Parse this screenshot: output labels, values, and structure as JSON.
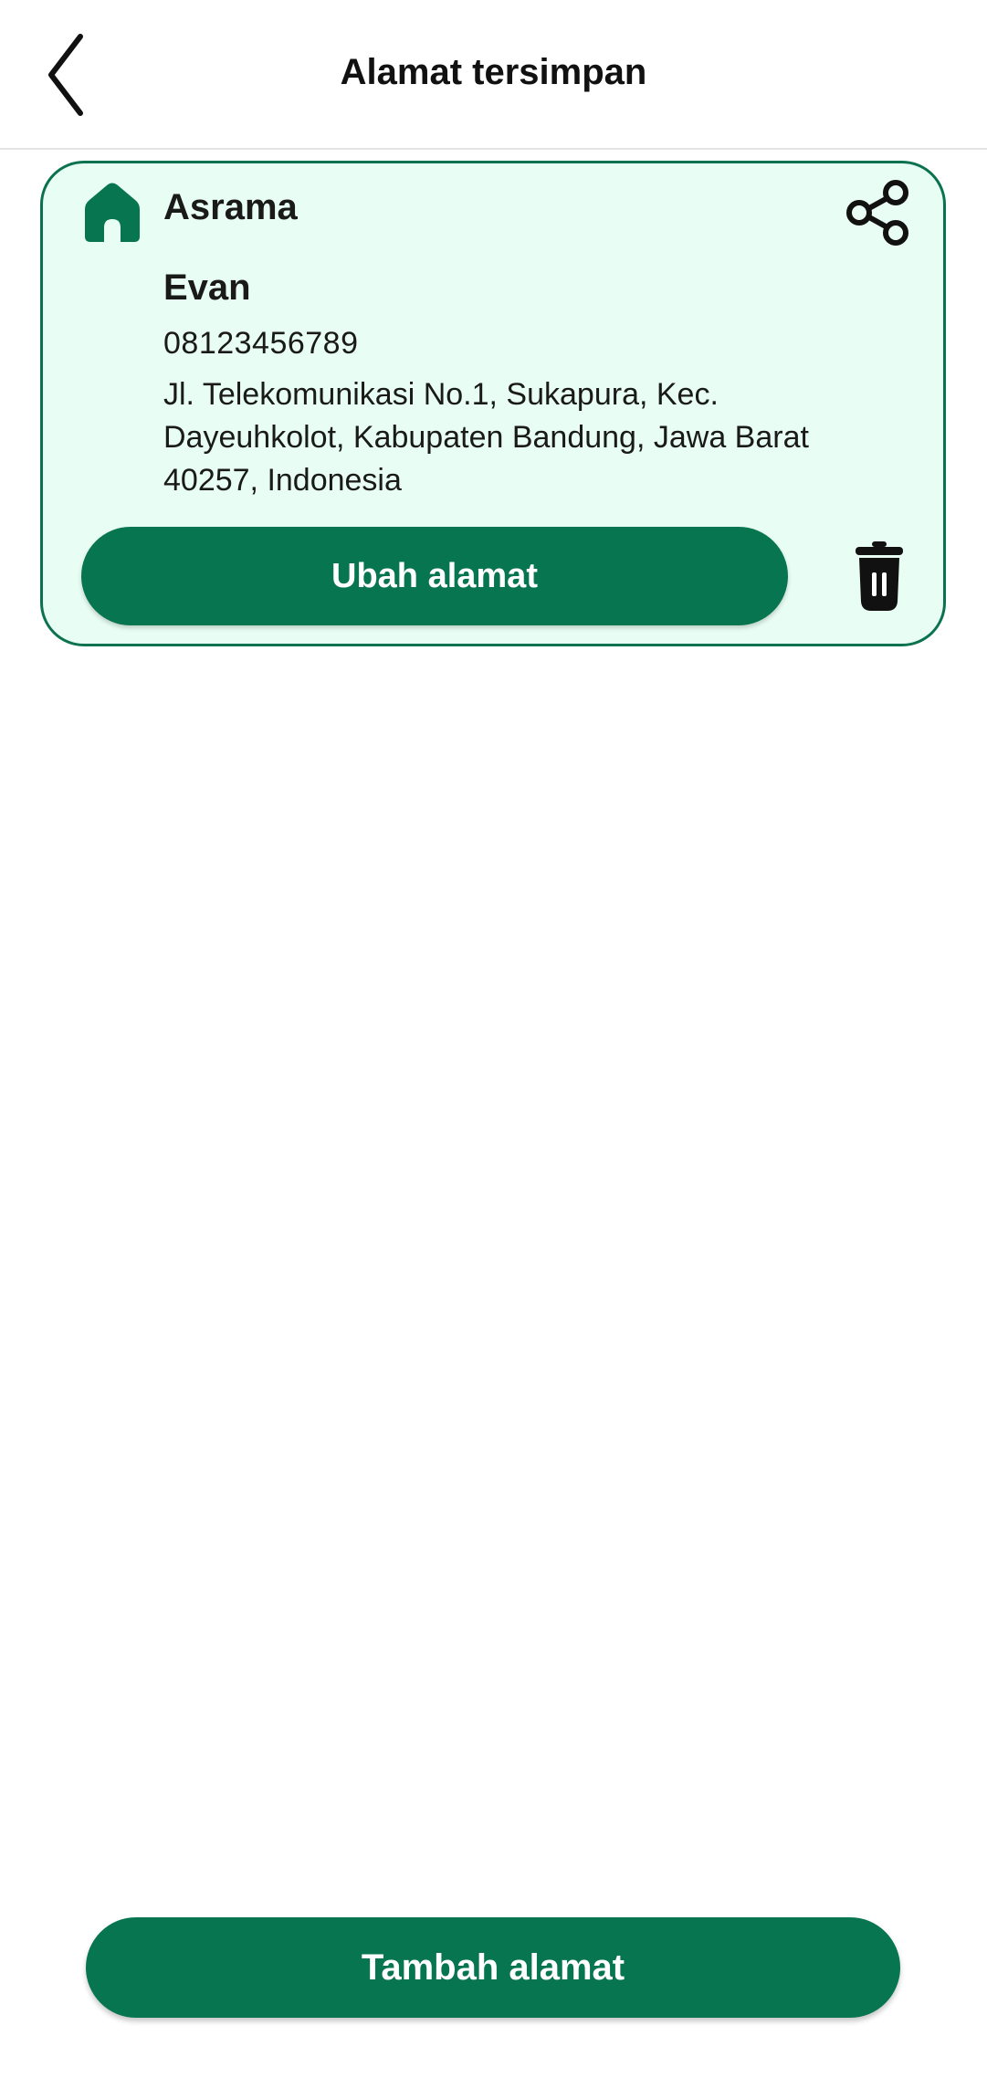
{
  "app_bar": {
    "title": "Alamat tersimpan",
    "back_icon": "chevron-left-icon"
  },
  "address": {
    "label": "Asrama",
    "label_icon": "home-icon",
    "name": "Evan",
    "phone": "08123456789",
    "full_address": "Jl. Telekomunikasi No.1, Sukapura, Kec. Dayeuhkolot, Kabupaten Bandung, Jawa Barat 40257, Indonesia",
    "share_icon": "share-icon",
    "edit_label": "Ubah alamat",
    "delete_icon": "trash-icon"
  },
  "footer": {
    "add_label": "Tambah alamat"
  },
  "colors": {
    "primary": "#07754f",
    "card_background": "#e8fdf4",
    "card_border": "#0b7250",
    "text": "#111111"
  }
}
